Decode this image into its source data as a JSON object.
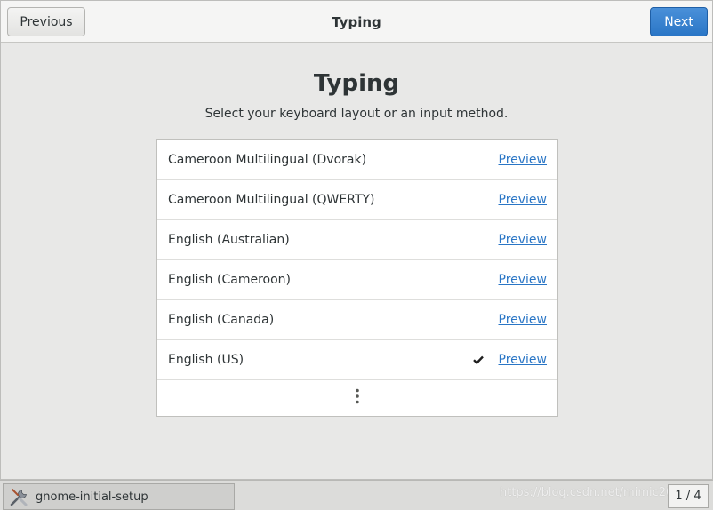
{
  "header": {
    "title": "Typing",
    "previous_label": "Previous",
    "next_label": "Next"
  },
  "page": {
    "heading": "Typing",
    "subtitle": "Select your keyboard layout or an input method."
  },
  "layouts": [
    {
      "label": "Cameroon Multilingual (Dvorak)",
      "preview": "Preview",
      "selected": false
    },
    {
      "label": "Cameroon Multilingual (QWERTY)",
      "preview": "Preview",
      "selected": false
    },
    {
      "label": "English (Australian)",
      "preview": "Preview",
      "selected": false
    },
    {
      "label": "English (Cameroon)",
      "preview": "Preview",
      "selected": false
    },
    {
      "label": "English (Canada)",
      "preview": "Preview",
      "selected": false
    },
    {
      "label": "English (US)",
      "preview": "Preview",
      "selected": true
    }
  ],
  "taskbar": {
    "app_label": "gnome-initial-setup",
    "pager": "1 / 4",
    "watermark": "https://blog.csdn.net/mimic2019"
  },
  "colors": {
    "accent": "#2a76c6",
    "background": "#e8e8e7"
  },
  "icons": {
    "check": "checkmark-icon",
    "more": "vertical-ellipsis-icon",
    "app": "tools-icon"
  }
}
